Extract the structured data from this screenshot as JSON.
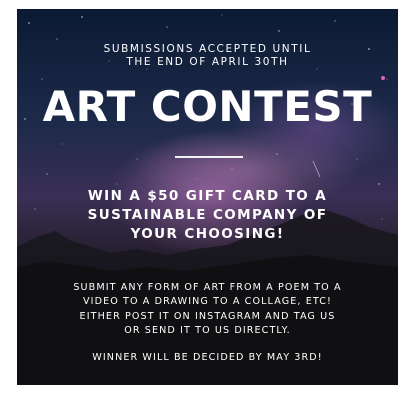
{
  "poster": {
    "submissions_line1": "SUBMISSIONS ACCEPTED UNTIL",
    "submissions_line2": "THE END OF APRIL 30TH",
    "title": "ART CONTEST",
    "prize_line1": "WIN A $50 GIFT CARD TO A",
    "prize_line2": "SUSTAINABLE COMPANY OF",
    "prize_line3": "YOUR CHOOSING!",
    "details_line1": "SUBMIT ANY FORM OF ART FROM A POEM TO A",
    "details_line2": "VIDEO TO A DRAWING TO A COLLAGE, ETC!",
    "details_line3": "EITHER POST IT ON INSTAGRAM AND TAG US",
    "details_line4": "OR SEND IT TO US DIRECTLY.",
    "winner_line": "WINNER WILL BE DECIDED BY MAY 3RD!",
    "text_color": "#ffffff",
    "background": "starry night sky over mountains"
  }
}
